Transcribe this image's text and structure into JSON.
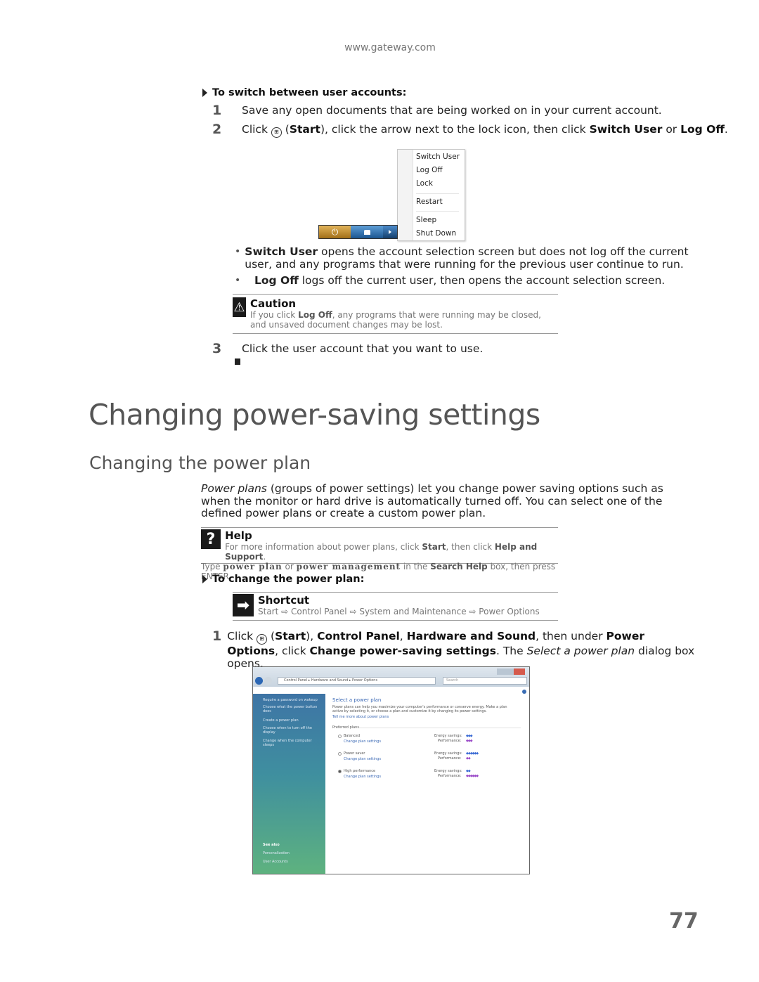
{
  "header": {
    "site": "www.gateway.com"
  },
  "switch_section": {
    "procedure_title": "To switch between user accounts:",
    "steps": [
      {
        "num": "1",
        "text": "Save any open documents that are being worked on in your current account."
      },
      {
        "num": "2",
        "pre": "Click",
        "start_icon": "windows-start-icon",
        "start": "Start",
        "mid": ", click the arrow next to the lock icon, then click",
        "b1": "Switch User",
        "or": "or",
        "b2": "Log Off",
        "end": "."
      },
      {
        "num": "3",
        "text": "Click the user account that you want to use."
      }
    ],
    "power_menu": {
      "items": [
        "Switch User",
        "Log Off",
        "Lock",
        "Restart",
        "Sleep",
        "Shut Down"
      ],
      "buttons": [
        "power-icon",
        "lock-icon",
        "arrow-icon"
      ]
    },
    "bullets": [
      {
        "bold": "Switch User",
        "text": "opens the account selection screen but does not log off the current user, and any programs that were running for the previous user continue to run."
      },
      {
        "bold": "Log Off",
        "text": "logs off the current user, then opens the account selection screen."
      }
    ],
    "caution": {
      "title": "Caution",
      "pre": "If you click",
      "bold": "Log Off",
      "post": ", any programs that were running may be closed, and unsaved document changes may be lost."
    }
  },
  "power_section": {
    "title": "Changing power-saving settings",
    "subtitle": "Changing the power plan",
    "intro_italic": "Power plans",
    "intro": "(groups of power settings) let you change power saving options such as when the monitor or hard drive is automatically turned off. You can select one of the defined power plans or create a custom power plan.",
    "help": {
      "title": "Help",
      "l1_pre": "For more information about power plans, click",
      "l1_b1": "Start",
      "l1_mid": ", then click",
      "l1_b2": "Help and Support",
      "l1_end": ".",
      "l2_pre": "Type",
      "l2_k1": "power plan",
      "l2_or": "or",
      "l2_k2": "power management",
      "l2_mid": "in the",
      "l2_b": "Search Help",
      "l2_end": "box, then press ENTER."
    },
    "procedure_title": "To change the power plan:",
    "shortcut": {
      "title": "Shortcut",
      "path": [
        "Start",
        "Control Panel",
        "System and Maintenance",
        "Power Options"
      ],
      "sep": "⇨"
    },
    "step1": {
      "num": "1",
      "pre": "Click",
      "start": "Start",
      "b1": "Control Panel",
      "b2": "Hardware and Sound",
      "mid": ", then under",
      "b3": "Power Options",
      "click": ", click",
      "b4": "Change power-saving settings",
      "post1": ". The",
      "italic": "Select a power plan",
      "post2": "dialog box opens."
    },
    "dialog": {
      "breadcrumb": [
        "Control Panel",
        "Hardware and Sound",
        "Power Options"
      ],
      "search_placeholder": "Search",
      "sidebar": [
        "Require a password on wakeup",
        "Choose what the power button does",
        "Create a power plan",
        "Choose when to turn off the display",
        "Change when the computer sleeps"
      ],
      "see_also": "See also",
      "see_also_items": [
        "Personalization",
        "User Accounts"
      ],
      "heading": "Select a power plan",
      "desc": "Power plans can help you maximize your computer's performance or conserve energy. Make a plan active by selecting it, or choose a plan and customize it by changing its power settings.",
      "desc_link": "Tell me more about power plans",
      "group": "Preferred plans",
      "plans": [
        {
          "name": "Balanced",
          "link": "Change plan settings",
          "selected": false,
          "energy": 3,
          "performance": 3
        },
        {
          "name": "Power saver",
          "link": "Change plan settings",
          "selected": false,
          "energy": 6,
          "performance": 2
        },
        {
          "name": "High performance",
          "link": "Change plan settings",
          "selected": true,
          "energy": 2,
          "performance": 6
        }
      ],
      "energy_label": "Energy savings:",
      "perf_label": "Performance:"
    }
  },
  "footer": {
    "page_number": "77"
  }
}
